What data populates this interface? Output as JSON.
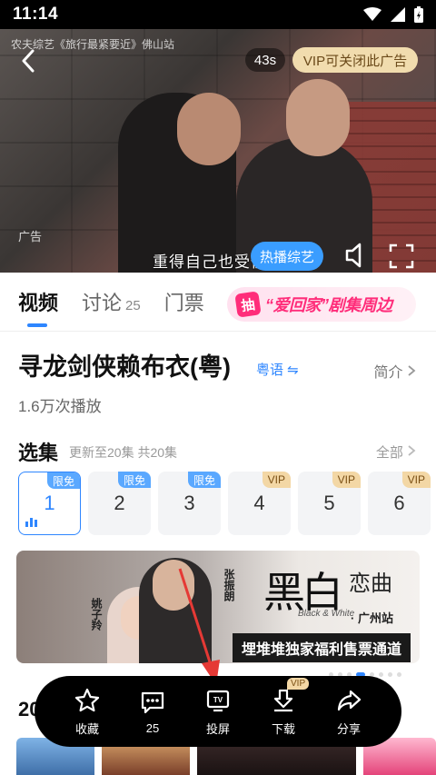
{
  "status_bar": {
    "time": "11:14"
  },
  "video": {
    "title": "农夫综艺《旅行最紧要近》佛山站",
    "countdown": "43s",
    "vip_close_ad": "VIP可关闭此广告",
    "ad_label": "广告",
    "hot_button": "热播综艺",
    "subtitle": "重得自己也受伤了"
  },
  "tabs": [
    {
      "label": "视频",
      "count": ""
    },
    {
      "label": "讨论",
      "count": "25"
    },
    {
      "label": "门票",
      "count": ""
    }
  ],
  "promo": {
    "mark": "抽",
    "text": "“爱回家”剧集周边"
  },
  "show": {
    "title": "寻龙剑侠赖布衣(粤)",
    "language": "粤语 ⇋",
    "intro": "简介",
    "plays": "1.6万次播放"
  },
  "episodes": {
    "heading": "选集",
    "subheading": "更新至20集 共20集",
    "all_label": "全部",
    "items": [
      {
        "num": "1",
        "badge": "限免",
        "badge_type": "free"
      },
      {
        "num": "2",
        "badge": "限免",
        "badge_type": "free"
      },
      {
        "num": "3",
        "badge": "限免",
        "badge_type": "free"
      },
      {
        "num": "4",
        "badge": "VIP",
        "badge_type": "vip"
      },
      {
        "num": "5",
        "badge": "VIP",
        "badge_type": "vip"
      },
      {
        "num": "6",
        "badge": "VIP",
        "badge_type": "vip"
      }
    ]
  },
  "banner": {
    "name_left": "姚子羚",
    "name_right": "张振朗",
    "logo_main": "黑白",
    "logo_small": "恋曲",
    "logo_en": "Black & White",
    "city": "· 广州站",
    "cta": "埋堆堆独家福利售票通道"
  },
  "section_heading": "20",
  "action_bar": {
    "favorite": "收藏",
    "comments": "25",
    "cast": "投屏",
    "download": "下载",
    "download_tag": "VIP",
    "share": "分享"
  },
  "colors": {
    "accent": "#2e86ff",
    "promo": "#ff2d7a",
    "vip": "#f3d7a5",
    "annotation": "#e53935"
  }
}
